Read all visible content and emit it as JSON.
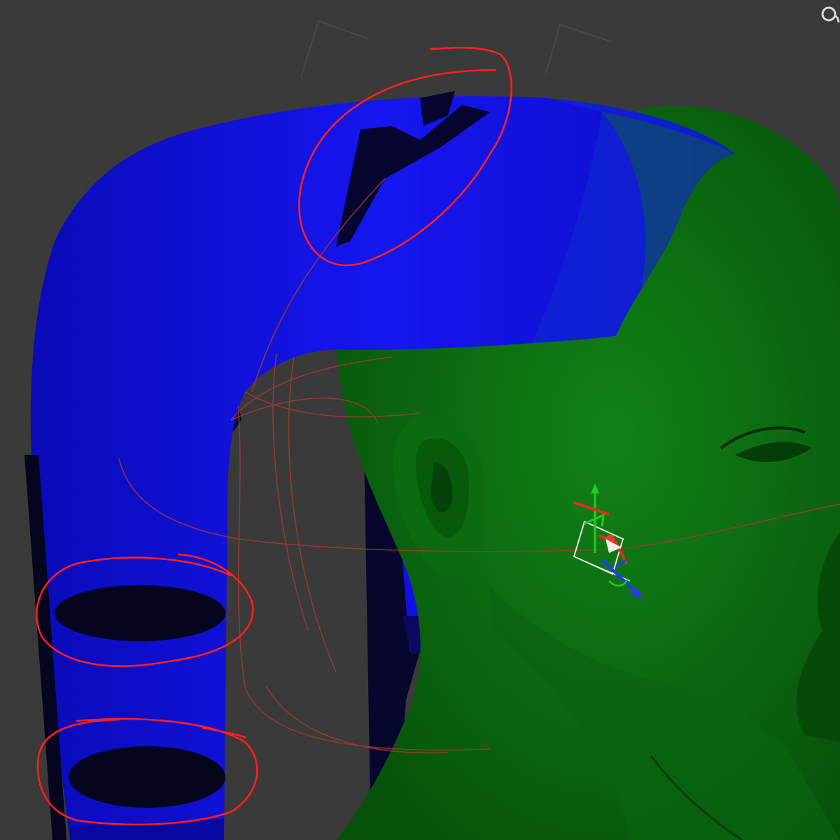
{
  "viewport": {
    "background": "#3a3a3a",
    "corner_icon": "orbit-icon"
  },
  "colors": {
    "hair_mesh": "#1010e6",
    "hair_shadow": "#060640",
    "head_mesh": "#0e6e12",
    "head_dark": "#074a0a",
    "annotation": "#ff1f1f",
    "bone_curve": "#a03a30",
    "gizmo_x": "#e0301e",
    "gizmo_y": "#1fcc1f",
    "gizmo_z": "#1f3aff",
    "gizmo_frame": "#e6e6e6"
  },
  "annotations": [
    {
      "name": "annotation-circle-top-gap"
    },
    {
      "name": "annotation-circle-band-upper"
    },
    {
      "name": "annotation-circle-band-lower"
    }
  ]
}
